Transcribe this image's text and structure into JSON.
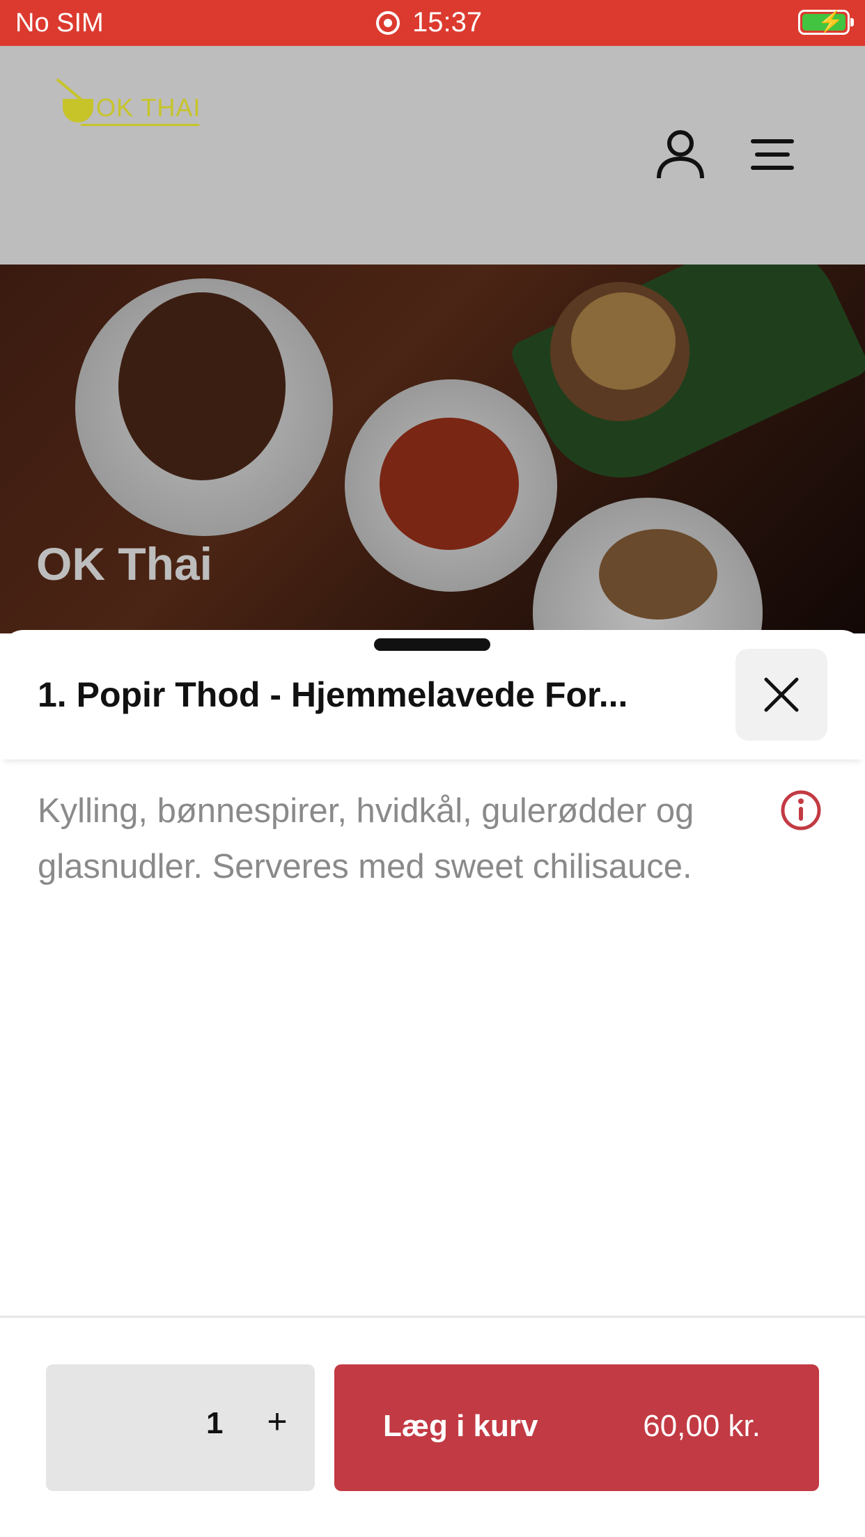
{
  "status_bar": {
    "carrier": "No SIM",
    "time": "15:37"
  },
  "brand": {
    "logo_text": "OK THAI",
    "restaurant_name": "OK Thai"
  },
  "header": {
    "user_icon": "user-icon",
    "menu_icon": "hamburger-menu-icon"
  },
  "sheet": {
    "item_title": "1. Popir Thod - Hjemmelavede For...",
    "description": "Kylling, bønnespirer, hvidkål, gulerødder og glasnudler. Serveres med sweet chilisauce.",
    "close_icon": "close-icon",
    "info_icon": "info-icon"
  },
  "footer": {
    "quantity": "1",
    "plus_label": "+",
    "add_label": "Læg i kurv",
    "price": "60,00 kr."
  },
  "colors": {
    "status_bar": "#dc3a2f",
    "accent": "#c23a43",
    "logo": "#c7c42a"
  }
}
